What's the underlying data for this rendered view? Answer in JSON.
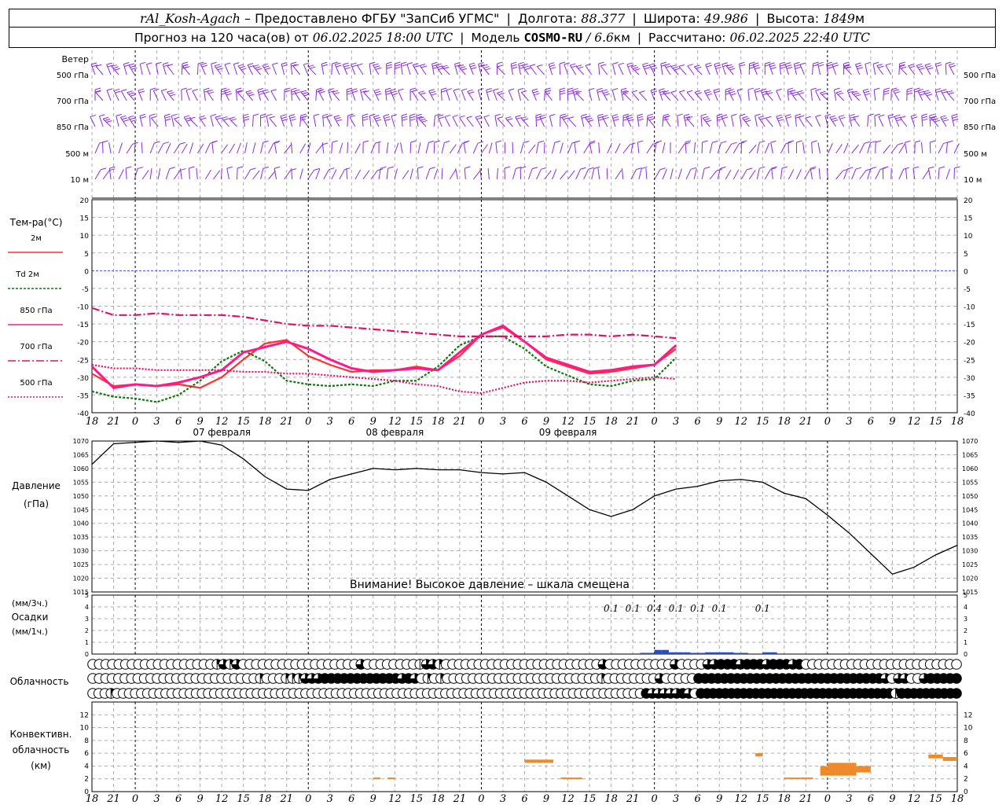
{
  "header": {
    "station": "rAl_Kosh-Agach",
    "dash": "–",
    "provider": "Предоставлено ФГБУ \"ЗапСиб УГМС\"",
    "lon_label": "Долгота:",
    "lon_value": "88.377",
    "lat_label": "Широта:",
    "lat_value": "49.986",
    "alt_label": "Высота:",
    "alt_value": "1849",
    "alt_unit": "м",
    "forecast_label": "Прогноз на 120 часа(ов)  от",
    "forecast_start": "06.02.2025 18:00 UTC",
    "model_label": "Модель",
    "model_name": "COSMO-RU",
    "model_res": "/ 6.6",
    "model_res_unit": "км",
    "calc_label": "Рассчитано:",
    "calc_time": "06.02.2025 22:40 UTC"
  },
  "wind_panel": {
    "title": "Ветер",
    "levels": [
      "500 гПа",
      "700 гПа",
      "850 гПа",
      "500 м",
      "10  м"
    ],
    "barb_color": "#8a2be2"
  },
  "chart_data": [
    {
      "type": "line",
      "title": "Тем-ра(°C)",
      "ylim": [
        -40,
        20
      ],
      "yticks": [
        20,
        15,
        10,
        5,
        0,
        -5,
        -10,
        -15,
        -20,
        -25,
        -30,
        -35,
        -40
      ],
      "x_ticks": [
        "18",
        "21",
        "0",
        "3",
        "6",
        "9",
        "12",
        "15",
        "18",
        "21",
        "0",
        "3",
        "6",
        "9",
        "12",
        "15",
        "18",
        "21",
        "0",
        "3",
        "6",
        "9",
        "12",
        "15",
        "18",
        "21",
        "0"
      ],
      "day_labels": [
        "07 февраля",
        "08 февраля",
        "09 февраля"
      ],
      "x_hours": [
        0,
        3,
        6,
        9,
        12,
        15,
        18,
        21,
        24,
        27,
        30,
        33,
        36,
        39,
        42,
        45,
        48,
        51,
        54,
        57,
        60,
        63,
        66,
        69,
        72,
        75,
        78,
        81
      ],
      "series": [
        {
          "name": "2м",
          "color": "#ff3030",
          "values": [
            -29,
            -32.5,
            -32,
            -32.5,
            -32,
            -33,
            -30,
            -25,
            -20.5,
            -19.5,
            -24,
            -26.5,
            -28.5,
            -28,
            -28,
            -27,
            -28,
            -24,
            -18,
            -16,
            -20,
            -25,
            -27,
            -29,
            -28.5,
            -27.5,
            -26.5,
            -22
          ]
        },
        {
          "name": "Td 2м",
          "color": "#0a7a0a",
          "values": [
            -34,
            -35.5,
            -36,
            -37,
            -35,
            -31,
            -25.5,
            -22.5,
            -25.5,
            -31,
            -32,
            -32.5,
            -32,
            -32.5,
            -31,
            -31,
            -27,
            -21,
            -18.5,
            -18.5,
            -22,
            -27,
            -29.5,
            -32,
            -32.5,
            -31,
            -30.5,
            -24.5
          ]
        },
        {
          "name": "850 гПа",
          "color": "#ff1a8c",
          "values": [
            -27,
            -33,
            -32,
            -32.5,
            -31.5,
            -30,
            -28,
            -23,
            -21.5,
            -20,
            -22,
            -25,
            -27.5,
            -28.5,
            -28,
            -27.5,
            -28,
            -23,
            -18,
            -15.5,
            -20,
            -24.5,
            -26.5,
            -28.5,
            -28,
            -27,
            -26.5,
            -21
          ]
        },
        {
          "name": "700 гПа",
          "color": "#e0106a",
          "values": [
            -10.5,
            -12.5,
            -12.5,
            -12,
            -12.5,
            -12.5,
            -12.5,
            -13,
            -14,
            -15,
            -15.5,
            -15.5,
            -16,
            -16.5,
            -17,
            -17.5,
            -18,
            -18.5,
            -18.5,
            -18.5,
            -18.5,
            -18.5,
            -18,
            -18,
            -18.5,
            -18,
            -18.5,
            -19
          ]
        },
        {
          "name": "500 гПа",
          "color": "#e0106a",
          "values": [
            -26.5,
            -27.5,
            -27.5,
            -28,
            -28,
            -28,
            -28,
            -28.5,
            -28.5,
            -29,
            -29,
            -29.5,
            -30,
            -30.5,
            -31,
            -32,
            -32.5,
            -34,
            -34.5,
            -33,
            -31.5,
            -31,
            -31,
            -31.5,
            -31,
            -30.5,
            -30,
            -30.5
          ]
        }
      ]
    },
    {
      "type": "line",
      "title": "Давление",
      "ylabel": "(гПа)",
      "ylim": [
        1015,
        1070
      ],
      "yticks": [
        1070,
        1065,
        1060,
        1055,
        1050,
        1045,
        1040,
        1035,
        1030,
        1025,
        1020,
        1015
      ],
      "note": "Внимание! Высокое давление – шкала смещена",
      "x_hours": [
        0,
        3,
        6,
        9,
        12,
        15,
        18,
        21,
        24,
        27,
        30,
        33,
        36,
        39,
        42,
        45,
        48,
        51,
        54,
        57,
        60,
        63,
        66,
        69,
        72,
        75,
        78,
        81,
        84,
        87,
        90,
        93,
        96,
        99,
        102,
        105,
        108,
        111,
        114,
        117,
        120
      ],
      "values": [
        1061.5,
        1069,
        1069.5,
        1070,
        1069.5,
        1070,
        1068.5,
        1063.5,
        1057,
        1052.5,
        1052,
        1056,
        1058,
        1060,
        1059.5,
        1060,
        1059.5,
        1059.5,
        1058.5,
        1058,
        1058.5,
        1055,
        1050,
        1045,
        1042.5,
        1045,
        1050,
        1052.5,
        1053.5,
        1055.5,
        1056,
        1055,
        1051,
        1049,
        1043,
        1036.5,
        1029,
        1021.5,
        1024,
        1028.5,
        1032
      ]
    },
    {
      "type": "bar",
      "title": "Осадки",
      "ylabel_top": "(мм/3ч.)",
      "ylabel_bottom": "(мм/1ч.)",
      "ylim": [
        0,
        5
      ],
      "yticks": [
        5,
        4,
        3,
        2,
        1,
        0
      ],
      "labels": [
        "0.1",
        "0.1",
        "0.4",
        "0.1",
        "0.1",
        "0.1",
        "0.1"
      ],
      "label_hours": [
        72,
        75,
        78,
        81,
        84,
        87,
        93
      ],
      "x_hours": [
        72,
        73,
        74,
        75,
        76,
        77,
        78,
        79,
        80,
        81,
        82,
        83,
        84,
        85,
        86,
        87,
        88,
        89,
        90,
        91,
        92,
        93,
        94,
        95
      ],
      "values": [
        0.05,
        0.05,
        0.05,
        0.05,
        0.1,
        0.1,
        0.35,
        0.35,
        0.15,
        0.15,
        0.15,
        0.1,
        0.1,
        0.15,
        0.15,
        0.15,
        0.15,
        0.1,
        0.1,
        0,
        0,
        0.15,
        0.15,
        0
      ]
    },
    {
      "type": "bar",
      "title": "Конвективн. облачность",
      "ylabel": "(км)",
      "ylim": [
        0,
        14
      ],
      "yticks": [
        12,
        10,
        8,
        6,
        4,
        2,
        0
      ],
      "segments": [
        {
          "h0": 39.0,
          "h1": 40.0,
          "km0": 2.0,
          "km1": 2.2
        },
        {
          "h0": 41.0,
          "h1": 42.0,
          "km0": 2.0,
          "km1": 2.2
        },
        {
          "h0": 60.0,
          "h1": 64.0,
          "km0": 4.5,
          "km1": 5.0
        },
        {
          "h0": 65.0,
          "h1": 68.0,
          "km0": 2.0,
          "km1": 2.2
        },
        {
          "h0": 92.0,
          "h1": 93.0,
          "km0": 5.5,
          "km1": 6.0
        },
        {
          "h0": 96.0,
          "h1": 100.0,
          "km0": 2.0,
          "km1": 2.2
        },
        {
          "h0": 101.0,
          "h1": 102.0,
          "km0": 2.5,
          "km1": 4.0
        },
        {
          "h0": 102.0,
          "h1": 106.0,
          "km0": 2.5,
          "km1": 4.5
        },
        {
          "h0": 106.0,
          "h1": 108.0,
          "km0": 3.0,
          "km1": 4.0
        },
        {
          "h0": 116.0,
          "h1": 118.0,
          "km0": 5.2,
          "km1": 5.8
        },
        {
          "h0": 118.0,
          "h1": 120.0,
          "km0": 4.8,
          "km1": 5.4
        }
      ]
    }
  ],
  "cloud_panel": {
    "title": "Облачность",
    "rows": [
      [
        0,
        0,
        0,
        0,
        0,
        0,
        0,
        0,
        0,
        0,
        0,
        0,
        0,
        0,
        0,
        0,
        0,
        0,
        0,
        2,
        3,
        2,
        3,
        0,
        0,
        0,
        0,
        0,
        0,
        0,
        0,
        0,
        0,
        0,
        0,
        0,
        0,
        0,
        0,
        0,
        0,
        3,
        0,
        0,
        0,
        0,
        0,
        0,
        0,
        0,
        1,
        3,
        3,
        2,
        0,
        0,
        0,
        0,
        0,
        0,
        0,
        0,
        0,
        0,
        0,
        0,
        0,
        0,
        0,
        0,
        0,
        0,
        0,
        0,
        0,
        0,
        0,
        0,
        3,
        0,
        0,
        0,
        0,
        0,
        0,
        0,
        0,
        0,
        0,
        3,
        0,
        0,
        0,
        0,
        3,
        3,
        4,
        4,
        4,
        3,
        4,
        4,
        4,
        3,
        4,
        4,
        4,
        3,
        4,
        0,
        0,
        0,
        0,
        0,
        0,
        0,
        0,
        0,
        0,
        0,
        0,
        0,
        0,
        0,
        0,
        0,
        0,
        0,
        0,
        0,
        0,
        0,
        0
      ],
      [
        0,
        0,
        0,
        0,
        0,
        0,
        0,
        0,
        0,
        0,
        0,
        0,
        0,
        0,
        0,
        0,
        0,
        0,
        0,
        0,
        0,
        0,
        0,
        0,
        0,
        0,
        2,
        0,
        0,
        0,
        2,
        2,
        2,
        3,
        3,
        3,
        4,
        4,
        4,
        4,
        4,
        4,
        4,
        4,
        4,
        4,
        4,
        4,
        3,
        4,
        3,
        0,
        2,
        0,
        2,
        0,
        0,
        0,
        0,
        0,
        0,
        0,
        0,
        0,
        0,
        0,
        0,
        0,
        0,
        0,
        0,
        0,
        0,
        0,
        0,
        0,
        0,
        0,
        0,
        2,
        0,
        0,
        0,
        0,
        0,
        0,
        0,
        0,
        3,
        0,
        0,
        0,
        0,
        0,
        4,
        4,
        4,
        4,
        4,
        4,
        4,
        4,
        4,
        4,
        4,
        4,
        4,
        4,
        4,
        4,
        4,
        4,
        4,
        4,
        4,
        4,
        4,
        4,
        4,
        4,
        4,
        4,
        4,
        3,
        0,
        3,
        3,
        0,
        0,
        3,
        4,
        4,
        4,
        4,
        4
      ],
      [
        0,
        0,
        0,
        2,
        0,
        0,
        0,
        0,
        0,
        0,
        0,
        0,
        0,
        0,
        0,
        0,
        0,
        0,
        0,
        0,
        0,
        0,
        0,
        0,
        0,
        0,
        0,
        0,
        0,
        0,
        0,
        0,
        0,
        0,
        0,
        0,
        0,
        0,
        0,
        0,
        0,
        0,
        0,
        0,
        0,
        0,
        0,
        0,
        0,
        0,
        0,
        0,
        0,
        0,
        0,
        0,
        0,
        0,
        0,
        0,
        0,
        0,
        0,
        0,
        0,
        0,
        0,
        0,
        0,
        0,
        0,
        0,
        0,
        0,
        0,
        0,
        0,
        0,
        0,
        0,
        0,
        0,
        0,
        0,
        0,
        0,
        0,
        0,
        0,
        0,
        0,
        4,
        3,
        3,
        3,
        3,
        3,
        4,
        3,
        0,
        4,
        4,
        4,
        4,
        4,
        4,
        4,
        4,
        4,
        4,
        4,
        4,
        4,
        4,
        4,
        4,
        4,
        4,
        4,
        4,
        4,
        4,
        4,
        4,
        4,
        4,
        4,
        4,
        4,
        4,
        4,
        4,
        2,
        4,
        4,
        4,
        4,
        4,
        4,
        4,
        4,
        4,
        4
      ]
    ]
  }
}
